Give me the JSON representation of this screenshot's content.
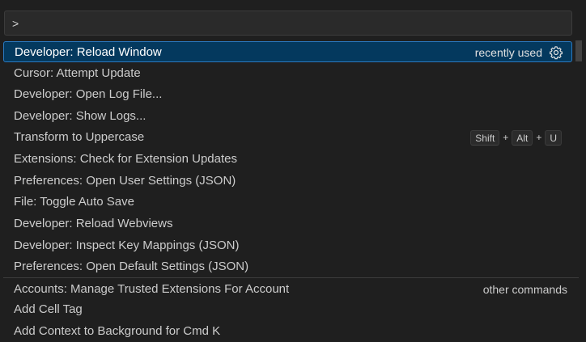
{
  "command_palette": {
    "input_value": ">",
    "items": [
      {
        "label": "Developer: Reload Window",
        "meta": "recently used",
        "icon": "gear-icon",
        "selected": true
      },
      {
        "label": "Cursor: Attempt Update"
      },
      {
        "label": "Developer: Open Log File..."
      },
      {
        "label": "Developer: Show Logs..."
      },
      {
        "label": "Transform to Uppercase",
        "keys": [
          "Shift",
          "Alt",
          "U"
        ],
        "key_separator": "+"
      },
      {
        "label": "Extensions: Check for Extension Updates"
      },
      {
        "label": "Preferences: Open User Settings (JSON)"
      },
      {
        "label": "File: Toggle Auto Save"
      },
      {
        "label": "Developer: Reload Webviews"
      },
      {
        "label": "Developer: Inspect Key Mappings (JSON)"
      },
      {
        "label": "Preferences: Open Default Settings (JSON)"
      },
      {
        "label": "Accounts: Manage Trusted Extensions For Account",
        "meta": "other commands"
      },
      {
        "label": "Add Cell Tag"
      },
      {
        "label": "Add Context to Background for Cmd K"
      }
    ]
  },
  "colors": {
    "background": "#1f1f1f",
    "selection": "#04395e",
    "selection_border": "#2b79c0"
  }
}
